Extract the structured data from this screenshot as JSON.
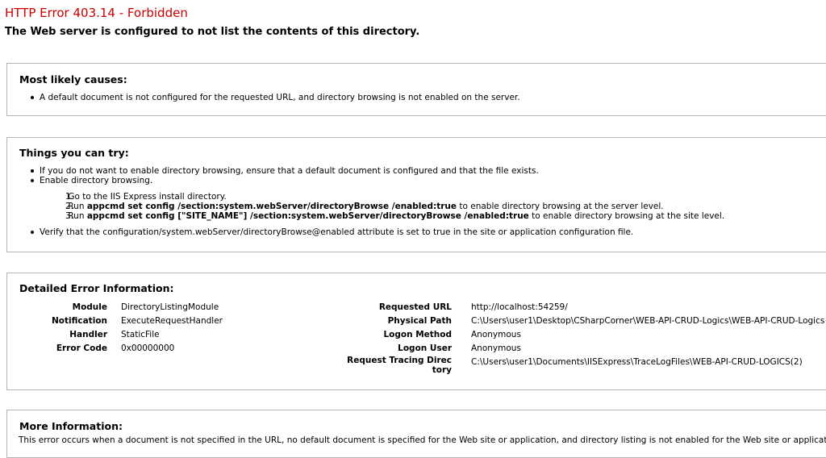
{
  "header": {
    "title": "HTTP Error 403.14 - Forbidden",
    "subtitle": "The Web server is configured to not list the contents of this directory."
  },
  "causes": {
    "heading": "Most likely causes:",
    "items": [
      "A default document is not configured for the requested URL, and directory browsing is not enabled on the server."
    ]
  },
  "try": {
    "heading": "Things you can try:",
    "item1": "If you do not want to enable directory browsing, ensure that a default document is configured and that the file exists.",
    "item2": "Enable directory browsing.",
    "steps": {
      "s1": "Go to the IIS Express install directory.",
      "s2_pre": "Run ",
      "s2_cmd": "appcmd set config /section:system.webServer/directoryBrowse /enabled:true",
      "s2_post": " to enable directory browsing at the server level.",
      "s3_pre": "Run ",
      "s3_cmd": "appcmd set config [\"SITE_NAME\"] /section:system.webServer/directoryBrowse /enabled:true",
      "s3_post": " to enable directory browsing at the site level."
    },
    "item3": "Verify that the configuration/system.webServer/directoryBrowse@enabled attribute is set to true in the site or application configuration file."
  },
  "details": {
    "heading": "Detailed Error Information:",
    "left": [
      {
        "label": "Module",
        "value": "DirectoryListingModule"
      },
      {
        "label": "Notification",
        "value": "ExecuteRequestHandler"
      },
      {
        "label": "Handler",
        "value": "StaticFile"
      },
      {
        "label": "Error Code",
        "value": "0x00000000"
      }
    ],
    "right": [
      {
        "label": "Requested URL",
        "value": "http://localhost:54259/"
      },
      {
        "label": "Physical Path",
        "value": "C:\\Users\\user1\\Desktop\\CSharpCorner\\WEB-API-CRUD-Logics\\WEB-API-CRUD-Logics"
      },
      {
        "label": "Logon Method",
        "value": "Anonymous"
      },
      {
        "label": "Logon User",
        "value": "Anonymous"
      },
      {
        "label": "Request Tracing Directory",
        "value": "C:\\Users\\user1\\Documents\\IISExpress\\TraceLogFiles\\WEB-API-CRUD-LOGICS(2)"
      }
    ],
    "tracing_label_line1": "Request Tracing Direc",
    "tracing_label_line2": "tory"
  },
  "more": {
    "heading": "More Information:",
    "text": "This error occurs when a document is not specified in the URL, no default document is specified for the Web site or application, and directory listing is not enabled for the Web site or application. Th"
  }
}
